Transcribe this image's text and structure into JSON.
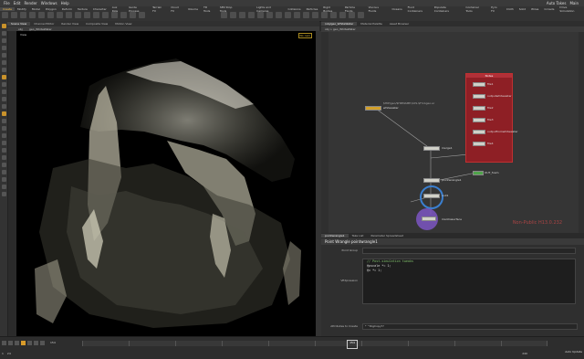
{
  "menubar": {
    "items": [
      "File",
      "Edit",
      "Render",
      "Windows",
      "Help"
    ],
    "right_items": [
      "Auto Takes",
      "Main"
    ]
  },
  "shelf": {
    "tabs": [
      "Create",
      "Modify",
      "Model",
      "Polygon",
      "Deform",
      "Texture",
      "Character",
      "Aux Rigs",
      "Guide Process",
      "Terrain FX",
      "Cloud FX",
      "Volume",
      "TD Tools",
      "SEK Stop Tools"
    ],
    "right_tabs": [
      "Lights and Cameras",
      "Collisions",
      "Particles",
      "Rigid Bodies",
      "Particle Fluids",
      "Viscous Fluids",
      "Oceans",
      "Fluid Containers",
      "Populate Containers",
      "Container Tools",
      "Pyro FX",
      "Cloth",
      "Solid",
      "Wires",
      "Crowds",
      "Drive Simulation"
    ]
  },
  "viewport": {
    "tabs": [
      "Scene View",
      "Channel Editor",
      "Render View",
      "Composite View",
      "Motion View"
    ],
    "path_label": "obj",
    "node_label": "geo_WhiteWater",
    "view_label": "View",
    "camera_label": "No cam"
  },
  "network": {
    "tabs": [
      "/obj/geo_WhiteWater",
      "Material Palette",
      "Asset Browser"
    ],
    "path": "obj > geo_WhiteWater",
    "box_title": "Notes",
    "nodes": [
      {
        "label": "file1"
      },
      {
        "label": "outputwhitewater"
      },
      {
        "label": "file2"
      },
      {
        "label": "file3"
      },
      {
        "label": "outputfromwhitewater"
      },
      {
        "label": "file4"
      },
      {
        "label": "whitewater"
      },
      {
        "label": "merge1"
      },
      {
        "label": "OUT_foam"
      },
      {
        "label": "pointwrangle1"
      },
      {
        "label": "null1"
      },
      {
        "label": "mantrasurface"
      }
    ],
    "file_path_label": "$HIP/geo/$HIPNAME.$OS.$F4.bgeo.sc",
    "watermark": "Non-Public H13.0.232"
  },
  "params": {
    "tabs": [
      "pointwrangle1",
      "Take List",
      "Parameter Spreadsheet"
    ],
    "header": "Point Wrangle  pointwrangle1",
    "group_label": "Point Group",
    "vex_label": "VEXpression",
    "vex_lines": [
      "// Post-simulation tweaks",
      "@pscale *= 1;",
      "@v *= 1;"
    ],
    "attr_label": "Attributes to Create",
    "attr_value": "* ^DigCopy??"
  },
  "timeline": {
    "start_frame": "1",
    "end_frame": "240",
    "current_frame": "154",
    "fps_label": "24",
    "status": "Auto Update"
  }
}
